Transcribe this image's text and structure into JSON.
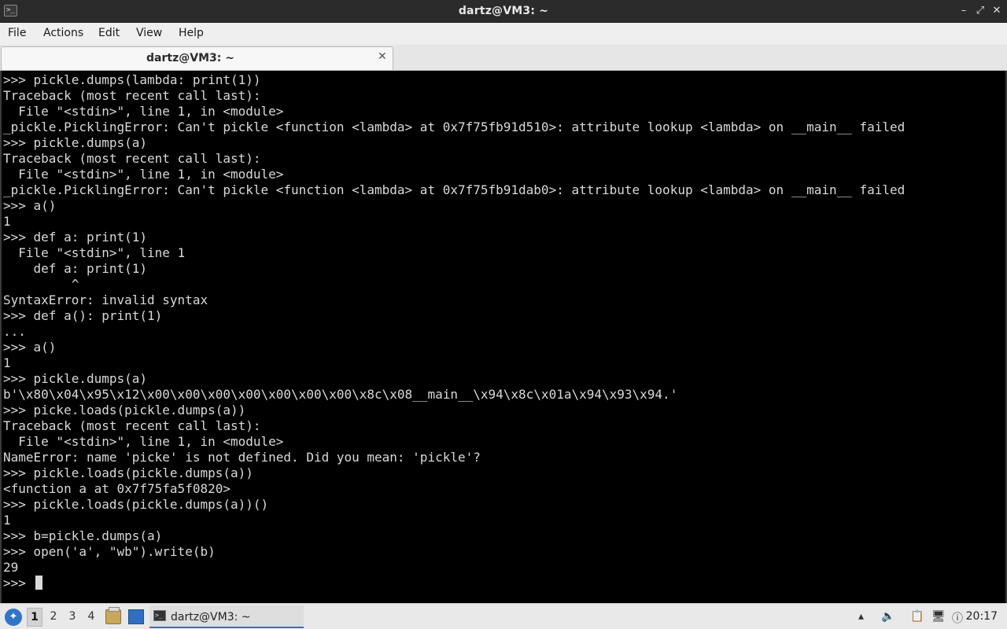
{
  "window": {
    "title": "dartz@VM3: ~",
    "app_icon": "terminal-icon",
    "controls": {
      "minimize": "–",
      "restore": "⤢",
      "close": "✕"
    }
  },
  "menu": {
    "items": [
      "File",
      "Actions",
      "Edit",
      "View",
      "Help"
    ]
  },
  "tabs": [
    {
      "label": "dartz@VM3: ~",
      "close": "✕"
    }
  ],
  "terminal": {
    "lines": [
      ">>> pickle.dumps(lambda: print(1))",
      "Traceback (most recent call last):",
      "  File \"<stdin>\", line 1, in <module>",
      "_pickle.PicklingError: Can't pickle <function <lambda> at 0x7f75fb91d510>: attribute lookup <lambda> on __main__ failed",
      ">>> pickle.dumps(a)",
      "Traceback (most recent call last):",
      "  File \"<stdin>\", line 1, in <module>",
      "_pickle.PicklingError: Can't pickle <function <lambda> at 0x7f75fb91dab0>: attribute lookup <lambda> on __main__ failed",
      ">>> a()",
      "1",
      ">>> def a: print(1)",
      "  File \"<stdin>\", line 1",
      "    def a: print(1)",
      "         ^",
      "SyntaxError: invalid syntax",
      ">>> def a(): print(1)",
      "...",
      ">>> a()",
      "1",
      ">>> pickle.dumps(a)",
      "b'\\x80\\x04\\x95\\x12\\x00\\x00\\x00\\x00\\x00\\x00\\x00\\x8c\\x08__main__\\x94\\x8c\\x01a\\x94\\x93\\x94.'",
      ">>> picke.loads(pickle.dumps(a))",
      "Traceback (most recent call last):",
      "  File \"<stdin>\", line 1, in <module>",
      "NameError: name 'picke' is not defined. Did you mean: 'pickle'?",
      ">>> pickle.loads(pickle.dumps(a))",
      "<function a at 0x7f75fa5f0820>",
      ">>> pickle.loads(pickle.dumps(a))()",
      "1",
      ">>> b=pickle.dumps(a)",
      ">>> open('a', \"wb\").write(b)",
      "29"
    ],
    "prompt": ">>> "
  },
  "taskbar": {
    "start_icon": "lxqt-menu-icon",
    "workspaces": [
      "1",
      "2",
      "3",
      "4"
    ],
    "active_workspace": "1",
    "launchers": [
      "file-manager-icon",
      "show-desktop-icon"
    ],
    "task": {
      "label": "dartz@VM3: ~",
      "icon": "terminal-icon"
    },
    "tray_icons": [
      "tray-expand-icon",
      "volume-icon",
      "clipboard-icon",
      "network-icon",
      "update-notifier-icon"
    ],
    "clock": "20:17"
  }
}
